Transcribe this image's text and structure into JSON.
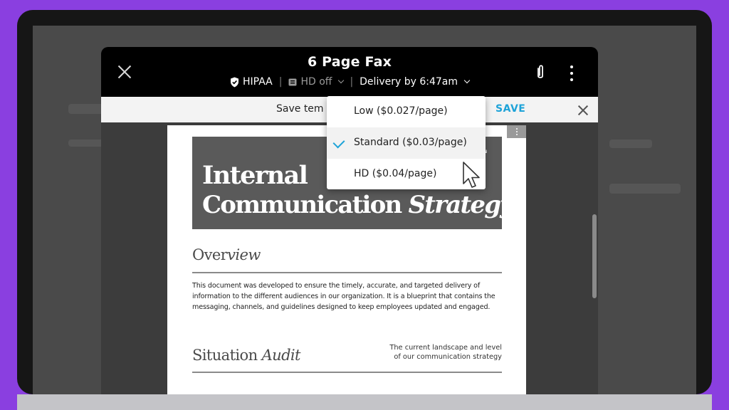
{
  "header": {
    "title": "6 Page Fax",
    "hipaa_label": "HIPAA",
    "hd_label": "HD off",
    "delivery_label": "Delivery by 6:47am"
  },
  "template_bar": {
    "label": "Save tem",
    "save_label": "SAVE"
  },
  "quality_dropdown": {
    "options": [
      {
        "label": "Low ($0.027/page)",
        "selected": false
      },
      {
        "label": "Standard ($0.03/page)",
        "selected": true
      },
      {
        "label": "HD ($0.04/page)",
        "selected": false
      }
    ]
  },
  "document": {
    "banner_line1": "Internal",
    "banner_line2_plain": "Communication",
    "banner_line2_italic": "Strategy",
    "banner_corner_text": "ON",
    "banner_corner_text2": "y",
    "overview_heading_plain": "Over",
    "overview_heading_italic": "view",
    "overview_lines": [
      "This document was developed to ensure the timely, accurate, and targeted delivery of",
      "information to the different audiences in our organization. It is a blueprint that contains the",
      "messaging, channels, and guidelines designed to keep employees updated and engaged."
    ],
    "audit_heading_plain": "Situation",
    "audit_heading_italic": "Audit",
    "audit_aside_lines": [
      "The current landscape and level",
      "of our communication strategy"
    ]
  },
  "colors": {
    "accent": "#1ea3d8",
    "frame_background": "#8a3fe0",
    "header_background": "#000000"
  }
}
